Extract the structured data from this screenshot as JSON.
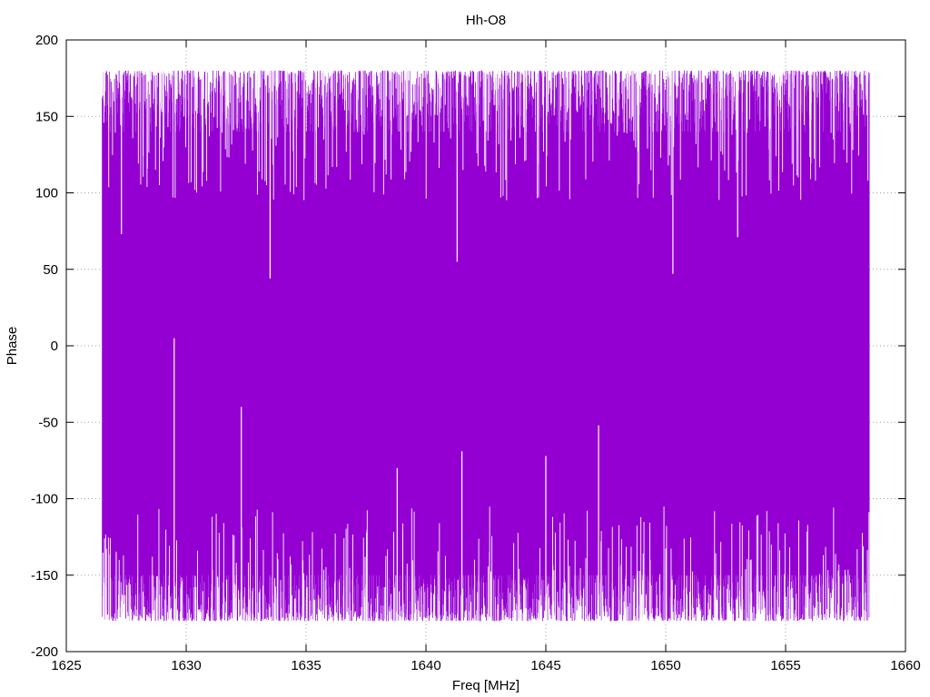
{
  "chart_data": {
    "type": "line",
    "title": "Hh-O8",
    "xlabel": "Freq [MHz]",
    "ylabel": "Phase",
    "xlim": [
      1625,
      1660
    ],
    "ylim": [
      -200,
      200
    ],
    "x_ticks": [
      "1625",
      "1630",
      "1635",
      "1640",
      "1645",
      "1650",
      "1655",
      "1660"
    ],
    "y_ticks": [
      "200",
      "150",
      "100",
      "50",
      "0",
      "-50",
      "-100",
      "-150",
      "-200"
    ],
    "grid": true,
    "legend": "none",
    "series": [
      {
        "color": "#9400d3",
        "x_range": [
          1626.5,
          1658.5
        ],
        "envelope_max": 180,
        "envelope_min": -180,
        "notable_dips": [
          {
            "x": 1627.3,
            "y": 73
          },
          {
            "x": 1633.5,
            "y": 44
          },
          {
            "x": 1641.3,
            "y": 55
          },
          {
            "x": 1650.3,
            "y": 47
          },
          {
            "x": 1653.0,
            "y": 71
          }
        ],
        "notable_rises": [
          {
            "x": 1629.5,
            "y": 5
          },
          {
            "x": 1632.3,
            "y": -40
          },
          {
            "x": 1641.5,
            "y": -69
          },
          {
            "x": 1647.2,
            "y": -52
          },
          {
            "x": 1645.0,
            "y": -72
          },
          {
            "x": 1638.8,
            "y": -80
          }
        ]
      }
    ]
  }
}
